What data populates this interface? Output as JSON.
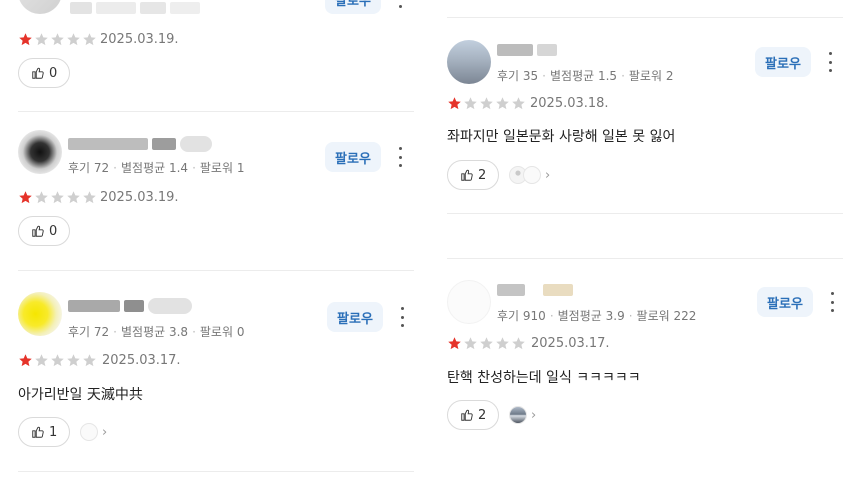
{
  "follow_label": "팔로우",
  "colors": {
    "star_filled": "#e5332a",
    "star_empty": "#cfcfcf",
    "accent": "#2b6fb8"
  },
  "left": [
    {
      "meta": null,
      "rating": 1,
      "date": "2025.03.19.",
      "text": "",
      "likes": "0"
    },
    {
      "meta": {
        "reviews": "후기 72",
        "avg": "별점평균 1.4",
        "followers": "팔로워 1"
      },
      "rating": 1,
      "date": "2025.03.19.",
      "text": "",
      "likes": "0"
    },
    {
      "meta": {
        "reviews": "후기 72",
        "avg": "별점평균 3.8",
        "followers": "팔로워 0"
      },
      "rating": 1,
      "date": "2025.03.17.",
      "text": "아가리반일 天滅中共",
      "likes": "1"
    }
  ],
  "right": [
    {
      "meta": {
        "reviews": "후기 35",
        "avg": "별점평균 1.5",
        "followers": "팔로워 2"
      },
      "rating": 1,
      "date": "2025.03.18.",
      "text": "좌파지만 일본문화 사랑해 일본 못 잃어",
      "likes": "2"
    },
    {
      "meta": {
        "reviews": "후기 910",
        "avg": "별점평균 3.9",
        "followers": "팔로워 222"
      },
      "rating": 1,
      "date": "2025.03.17.",
      "text": "탄핵 찬성하는데 일식 ㅋㅋㅋㅋㅋ",
      "likes": "2"
    }
  ]
}
